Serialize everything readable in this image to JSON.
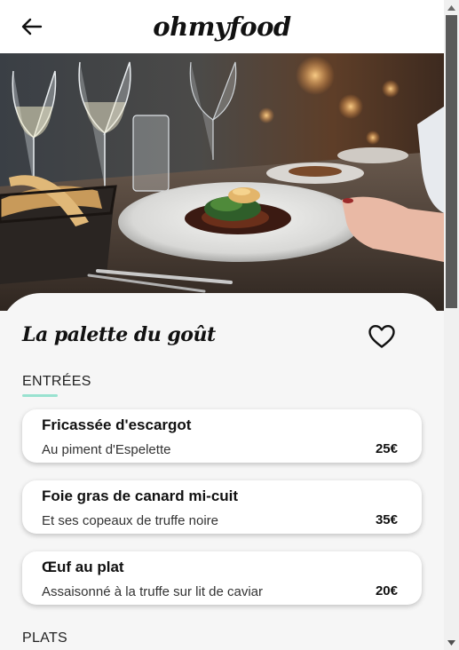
{
  "header": {
    "logo": "ohmyfood",
    "back_icon": "arrow-left-icon"
  },
  "hero": {
    "alt": "Restaurant table with plated dish"
  },
  "restaurant": {
    "name": "La palette du goût",
    "favorite_icon": "heart-outline-icon"
  },
  "menu": {
    "entrees": {
      "label": "ENTRÉES",
      "items": [
        {
          "name": "Fricassée d'escargot",
          "description": "Au piment d'Espelette",
          "price": "25€"
        },
        {
          "name": "Foie gras de canard mi-cuit",
          "description": "Et ses copeaux de truffe noire",
          "price": "35€"
        },
        {
          "name": "Œuf au plat",
          "description": "Assaisonné à la truffe sur lit de caviar",
          "price": "20€"
        }
      ]
    },
    "plats": {
      "label": "PLATS"
    }
  },
  "colors": {
    "accent": "#99e2d0",
    "background": "#f6f6f6"
  }
}
